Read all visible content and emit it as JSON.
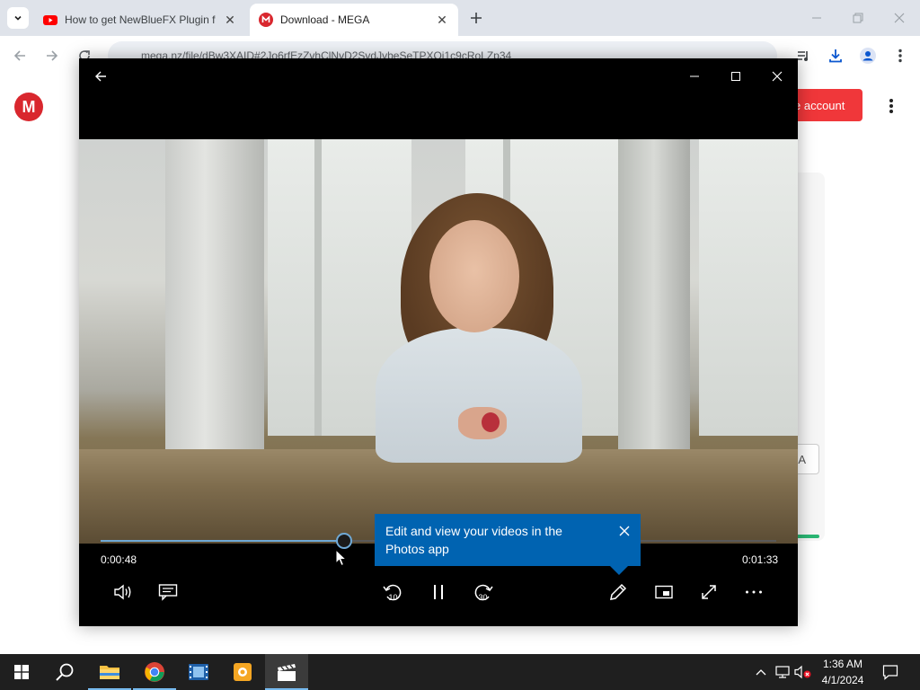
{
  "browser": {
    "tabs": [
      {
        "title": "How to get NewBlueFX Plugin f",
        "active": false
      },
      {
        "title": "Download - MEGA",
        "active": true
      }
    ],
    "address": "mega.nz/file/dBw3XAID#2Jo6rfEzZvhClNvD2SvdJvbeSeTPXOj1c9cRoLZp34",
    "page": {
      "logo_letter": "M",
      "create_account_label": "e account",
      "card_button_fragment": "A"
    }
  },
  "player": {
    "elapsed": "0:00:48",
    "duration": "0:01:33",
    "progress_fraction": 0.36,
    "tooltip_text": "Edit and view your videos in the Photos app"
  },
  "taskbar": {
    "time": "1:36 AM",
    "date": "4/1/2024"
  },
  "colors": {
    "accent": "#0063b1",
    "seek": "#6fa9d6",
    "mega_red": "#d9272e"
  }
}
